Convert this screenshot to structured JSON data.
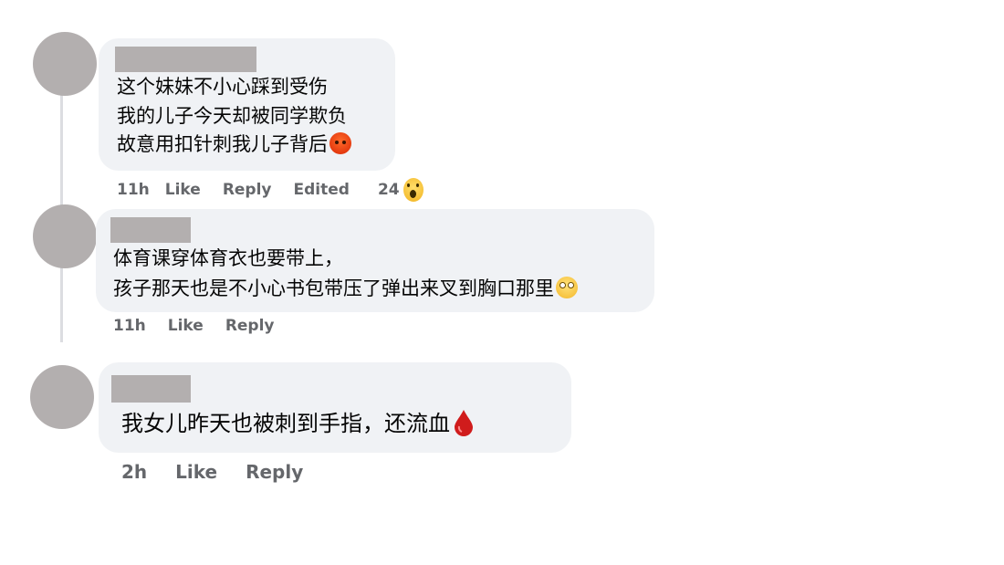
{
  "colors": {
    "bubble_bg": "#f0f2f5",
    "avatar_placeholder": "#b3afaf",
    "meta_text": "#65676b",
    "thread_line": "#dcdde1"
  },
  "comments": [
    {
      "lines": [
        "这个妹妹不小心踩到受伤",
        "我的儿子今天却被同学欺负",
        "故意用扣针刺我儿子背后"
      ],
      "end_emoji": "angry-face-emoji",
      "time": "11h",
      "like_label": "Like",
      "reply_label": "Reply",
      "edited_label": "Edited",
      "reaction_count": "24",
      "reaction_icon": "wow-reaction-icon"
    },
    {
      "lines": [
        "体育课穿体育衣也要带上，",
        "孩子那天也是不小心书包带压了弹出来叉到胸口那里"
      ],
      "end_emoji": "eye-roll-emoji",
      "time": "11h",
      "like_label": "Like",
      "reply_label": "Reply"
    },
    {
      "lines": [
        "我女儿昨天也被刺到手指，还流血"
      ],
      "end_emoji": "drop-of-blood-emoji",
      "time": "2h",
      "like_label": "Like",
      "reply_label": "Reply"
    }
  ]
}
